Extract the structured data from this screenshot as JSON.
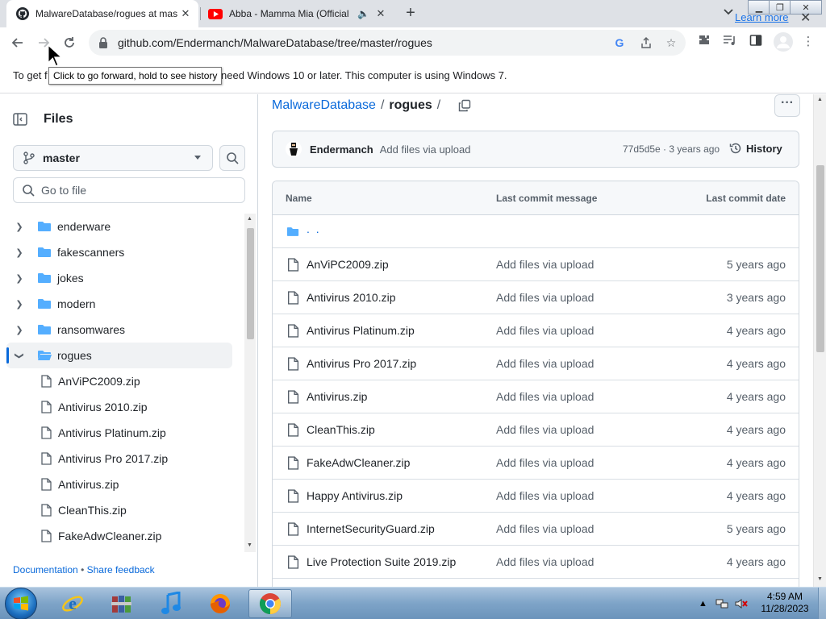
{
  "browser": {
    "tabs": [
      {
        "title": "MalwareDatabase/rogues at mas",
        "active": true
      },
      {
        "title": "Abba - Mamma Mia (Official",
        "active": false
      }
    ],
    "url": "github.com/Endermanch/MalwareDatabase/tree/master/rogues",
    "tooltip": "Click to go forward, hold to see history",
    "infobar": {
      "text": "To get f                                                     need Windows 10 or later. This computer is using Windows 7.",
      "text_visible_left": "To get f",
      "text_visible_right": "need Windows 10 or later. This computer is using Windows 7.",
      "link": "Learn more"
    }
  },
  "sidebar": {
    "title": "Files",
    "branch": "master",
    "goto_placeholder": "Go to file",
    "folders": [
      {
        "label": "enderware"
      },
      {
        "label": "fakescanners"
      },
      {
        "label": "jokes"
      },
      {
        "label": "modern"
      },
      {
        "label": "ransomwares"
      },
      {
        "label": "rogues",
        "expanded": true
      }
    ],
    "files": [
      {
        "label": "AnViPC2009.zip"
      },
      {
        "label": "Antivirus 2010.zip"
      },
      {
        "label": "Antivirus Platinum.zip"
      },
      {
        "label": "Antivirus Pro 2017.zip"
      },
      {
        "label": "Antivirus.zip"
      },
      {
        "label": "CleanThis.zip"
      },
      {
        "label": "FakeAdwCleaner.zip"
      }
    ],
    "footer": {
      "documentation": "Documentation",
      "separator": "•",
      "feedback": "Share feedback"
    }
  },
  "main": {
    "breadcrumb": {
      "repo": "MalwareDatabase",
      "sep1": "/",
      "current": "rogues",
      "sep2": "/"
    },
    "commit": {
      "author": "Endermanch",
      "message": "Add files via upload",
      "meta": "77d5d5e · 3 years ago",
      "history_label": "History"
    },
    "table": {
      "headers": {
        "name": "Name",
        "message": "Last commit message",
        "date": "Last commit date"
      },
      "parent": ". .",
      "rows": [
        {
          "name": "AnViPC2009.zip",
          "message": "Add files via upload",
          "date": "5 years ago"
        },
        {
          "name": "Antivirus 2010.zip",
          "message": "Add files via upload",
          "date": "3 years ago"
        },
        {
          "name": "Antivirus Platinum.zip",
          "message": "Add files via upload",
          "date": "4 years ago"
        },
        {
          "name": "Antivirus Pro 2017.zip",
          "message": "Add files via upload",
          "date": "4 years ago"
        },
        {
          "name": "Antivirus.zip",
          "message": "Add files via upload",
          "date": "4 years ago"
        },
        {
          "name": "CleanThis.zip",
          "message": "Add files via upload",
          "date": "4 years ago"
        },
        {
          "name": "FakeAdwCleaner.zip",
          "message": "Add files via upload",
          "date": "4 years ago"
        },
        {
          "name": "Happy Antivirus.zip",
          "message": "Add files via upload",
          "date": "4 years ago"
        },
        {
          "name": "InternetSecurityGuard.zip",
          "message": "Add files via upload",
          "date": "5 years ago"
        },
        {
          "name": "Live Protection Suite 2019.zip",
          "message": "Add files via upload",
          "date": "4 years ago"
        }
      ]
    }
  },
  "taskbar": {
    "time": "4:59 AM",
    "date": "11/28/2023"
  },
  "colors": {
    "link": "#0969da",
    "folder": "#54aeff",
    "chrome_tab_strip": "#dee1e6",
    "youtube_red": "#ff0000"
  }
}
